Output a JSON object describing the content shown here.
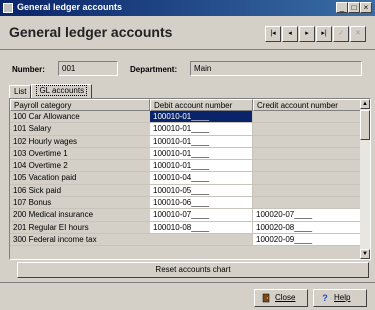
{
  "window": {
    "title": "General ledger accounts",
    "min_glyph": "_",
    "max_glyph": "□",
    "close_glyph": "×"
  },
  "header": {
    "title": "General ledger accounts",
    "nav": {
      "first": "|◂",
      "prev": "◂",
      "next": "▸",
      "last": "▸|",
      "confirm": "✓",
      "cancel": "✕"
    }
  },
  "fields": {
    "number_label": "Number:",
    "number_value": "001",
    "department_label": "Department:",
    "department_value": "Main"
  },
  "tabs": [
    "List",
    "GL accounts"
  ],
  "table": {
    "columns": [
      "Payroll category",
      "Debit account number",
      "Credit account number"
    ],
    "rows": [
      {
        "category": "100 Car Allowance",
        "debit": "100010-01____",
        "credit": ""
      },
      {
        "category": "101 Salary",
        "debit": "100010-01____",
        "credit": ""
      },
      {
        "category": "102 Hourly wages",
        "debit": "100010-01____",
        "credit": ""
      },
      {
        "category": "103 Overtime 1",
        "debit": "100010-01____",
        "credit": ""
      },
      {
        "category": "104 Overtime 2",
        "debit": "100010-01____",
        "credit": ""
      },
      {
        "category": "105 Vacation paid",
        "debit": "100010-04____",
        "credit": ""
      },
      {
        "category": "106 Sick paid",
        "debit": "100010-05____",
        "credit": ""
      },
      {
        "category": "107 Bonus",
        "debit": "100010-06____",
        "credit": ""
      },
      {
        "category": "200 Medical insurance",
        "debit": "100010-07____",
        "credit": "100020-07____"
      },
      {
        "category": "201 Regular EI hours",
        "debit": "100010-08____",
        "credit": "100020-08____"
      },
      {
        "category": "300 Federal income tax",
        "debit": "",
        "credit": "100020-09____"
      }
    ]
  },
  "scrollbar": {
    "up": "▲",
    "down": "▼"
  },
  "reset_button": "Reset accounts chart",
  "footer": {
    "close_label": "Close",
    "help_label": "Help",
    "help_icon": "?"
  }
}
